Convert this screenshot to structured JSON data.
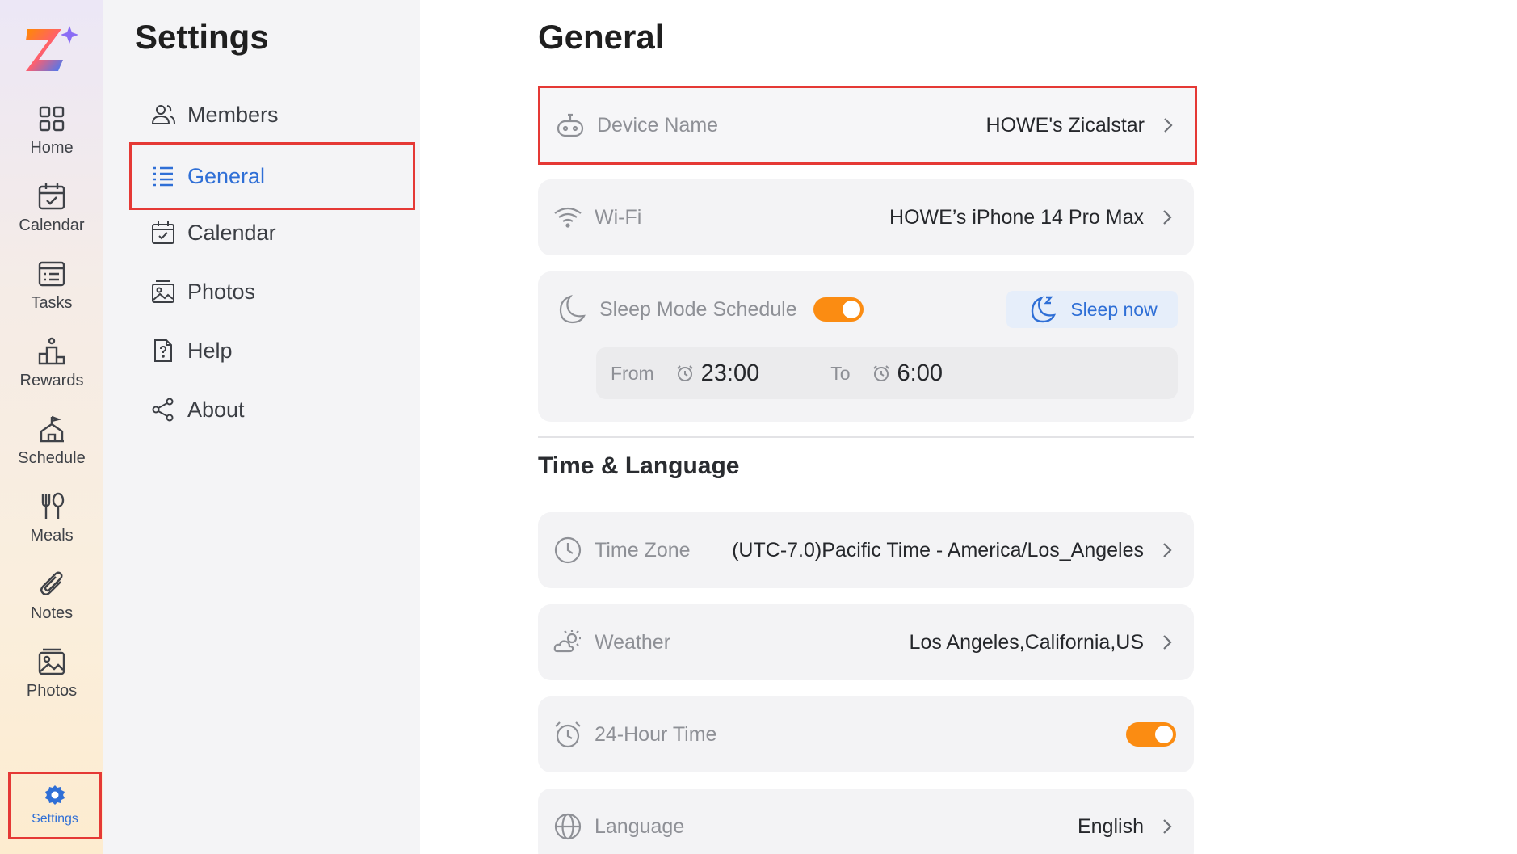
{
  "nav": {
    "items": [
      {
        "label": "Home",
        "icon": "home-grid-icon"
      },
      {
        "label": "Calendar",
        "icon": "calendar-icon"
      },
      {
        "label": "Tasks",
        "icon": "tasks-list-icon"
      },
      {
        "label": "Rewards",
        "icon": "rewards-icon"
      },
      {
        "label": "Schedule",
        "icon": "schedule-icon"
      },
      {
        "label": "Meals",
        "icon": "meals-icon"
      },
      {
        "label": "Notes",
        "icon": "paperclip-icon"
      },
      {
        "label": "Photos",
        "icon": "photos-icon"
      }
    ],
    "settings_label": "Settings"
  },
  "settings_menu": {
    "title": "Settings",
    "items": [
      {
        "label": "Members",
        "icon": "members-icon"
      },
      {
        "label": "General",
        "icon": "general-list-icon",
        "active": true
      },
      {
        "label": "Calendar",
        "icon": "calendar-icon"
      },
      {
        "label": "Photos",
        "icon": "photos-icon"
      },
      {
        "label": "Help",
        "icon": "help-icon"
      },
      {
        "label": "About",
        "icon": "share-icon"
      }
    ]
  },
  "general": {
    "title": "General",
    "device_name": {
      "label": "Device Name",
      "value": "HOWE's Zicalstar"
    },
    "wifi": {
      "label": "Wi-Fi",
      "value": "HOWE’s iPhone 14 Pro Max"
    },
    "sleep": {
      "label": "Sleep Mode Schedule",
      "enabled": true,
      "sleep_now_label": "Sleep now",
      "from_label": "From",
      "from_time": "23:00",
      "to_label": "To",
      "to_time": "6:00"
    },
    "time_language": {
      "title": "Time & Language",
      "time_zone": {
        "label": "Time Zone",
        "value": "(UTC-7.0)Pacific Time - America/Los_Angeles"
      },
      "weather": {
        "label": "Weather",
        "value": "Los Angeles,California,US"
      },
      "hour24": {
        "label": "24-Hour Time",
        "enabled": true
      },
      "language": {
        "label": "Language",
        "value": "English"
      }
    }
  },
  "colors": {
    "accent_blue": "#2f6fd6",
    "toggle_orange": "#fb8c12",
    "highlight_red": "#e53935"
  }
}
